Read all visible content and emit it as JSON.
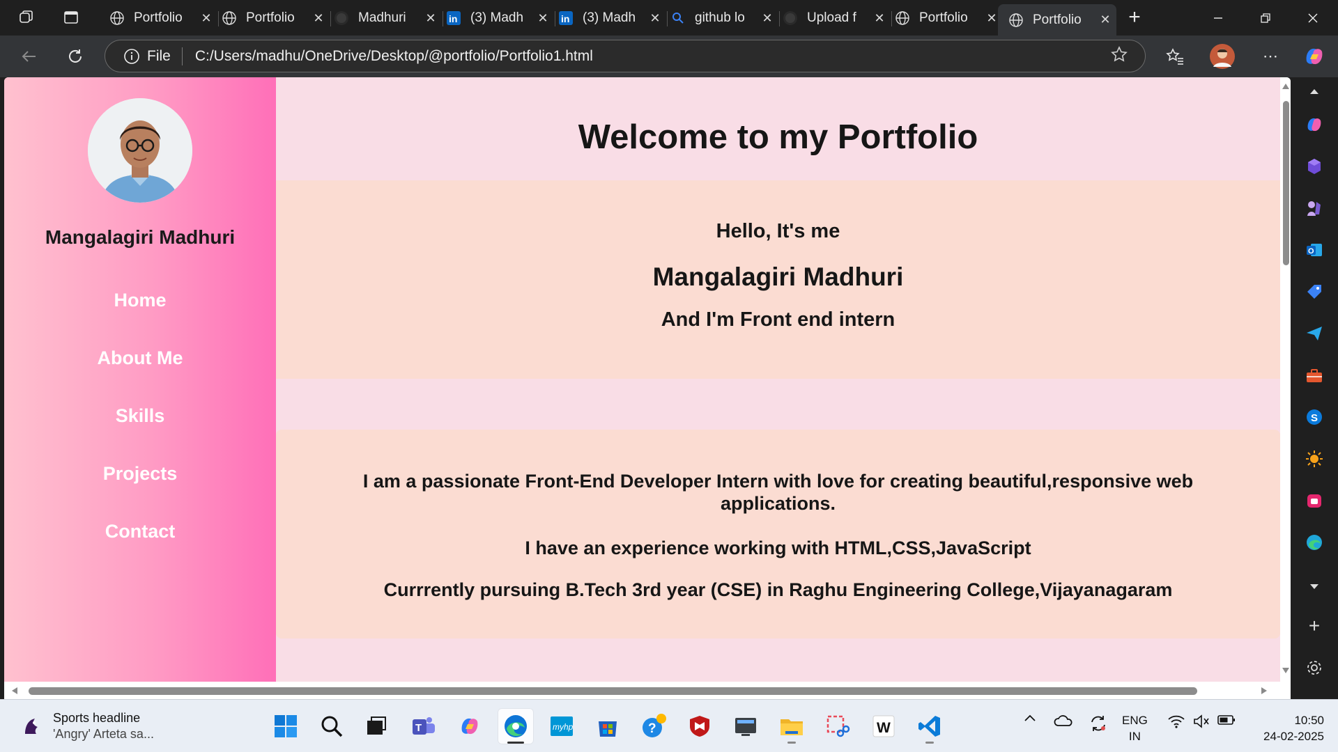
{
  "browser": {
    "tabs": [
      {
        "title": "Portfolio",
        "icon": "globe"
      },
      {
        "title": "Portfolio",
        "icon": "globe"
      },
      {
        "title": "Madhuri",
        "icon": "github"
      },
      {
        "title": "(3) Madh",
        "icon": "linkedin"
      },
      {
        "title": "(3) Madh",
        "icon": "linkedin"
      },
      {
        "title": "github lo",
        "icon": "search"
      },
      {
        "title": "Upload f",
        "icon": "github"
      },
      {
        "title": "Portfolio",
        "icon": "globe"
      },
      {
        "title": "Portfolio",
        "icon": "globe",
        "active": true
      }
    ],
    "address": {
      "protocol": "File",
      "url": "C:/Users/madhu/OneDrive/Desktop/@portfolio/Portfolio1.html"
    }
  },
  "page": {
    "sidebar": {
      "name": "Mangalagiri Madhuri",
      "nav": [
        "Home",
        "About Me",
        "Skills",
        "Projects",
        "Contact"
      ]
    },
    "welcome": "Welcome to my Portfolio",
    "hero": {
      "greeting": "Hello, It's me",
      "name": "Mangalagiri Madhuri",
      "role": "And I'm Front end intern"
    },
    "about": {
      "p1": "I am a passionate Front-End Developer Intern with love for creating beautiful,responsive web applications.",
      "p2": "I have an experience working with HTML,CSS,JavaScript",
      "p3": "Currrently pursuing B.Tech 3rd year (CSE) in Raghu Engineering College,Vijayanagaram"
    }
  },
  "taskbar": {
    "news_title": "Sports headline",
    "news_sub": "'Angry' Arteta sa...",
    "language": "ENG",
    "region": "IN",
    "time": "10:50",
    "date": "24-02-2025"
  },
  "colors": {
    "sidebar_gradient_start": "#ffc1cf",
    "sidebar_gradient_end": "#ff6fb8",
    "main_bg": "#f9dde6",
    "card_bg": "#fbdcd2"
  }
}
